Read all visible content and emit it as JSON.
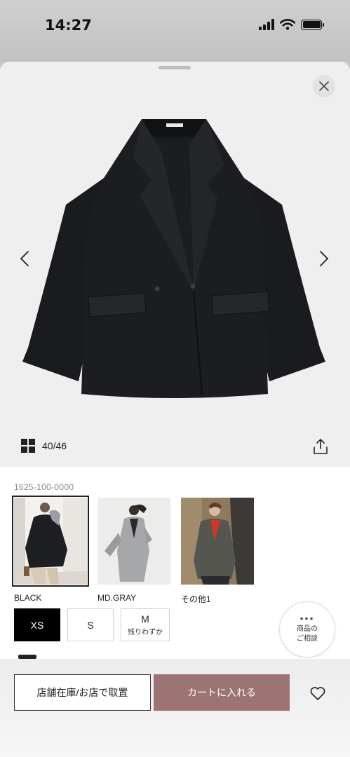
{
  "status_bar": {
    "time": "14:27"
  },
  "gallery": {
    "current": "40/46",
    "icons": [
      "close-icon",
      "chevron-left-icon",
      "chevron-right-icon",
      "grid-icon",
      "share-icon"
    ]
  },
  "product": {
    "code": "1625-100-0000"
  },
  "colors": [
    {
      "label": "BLACK",
      "selected": true
    },
    {
      "label": "MD.GRAY",
      "selected": false
    },
    {
      "label": "その他1",
      "selected": false
    }
  ],
  "sizes": [
    {
      "label": "XS",
      "note": "",
      "selected": true
    },
    {
      "label": "S",
      "note": "",
      "selected": false
    },
    {
      "label": "M",
      "note": "残りわずか",
      "selected": false
    }
  ],
  "consult": {
    "line1": "商品の",
    "line2": "ご相談"
  },
  "actions": {
    "store_label": "店舗在庫/お店で取置",
    "cart_label": "カートに入れる",
    "cart_color": "#9d7474"
  }
}
